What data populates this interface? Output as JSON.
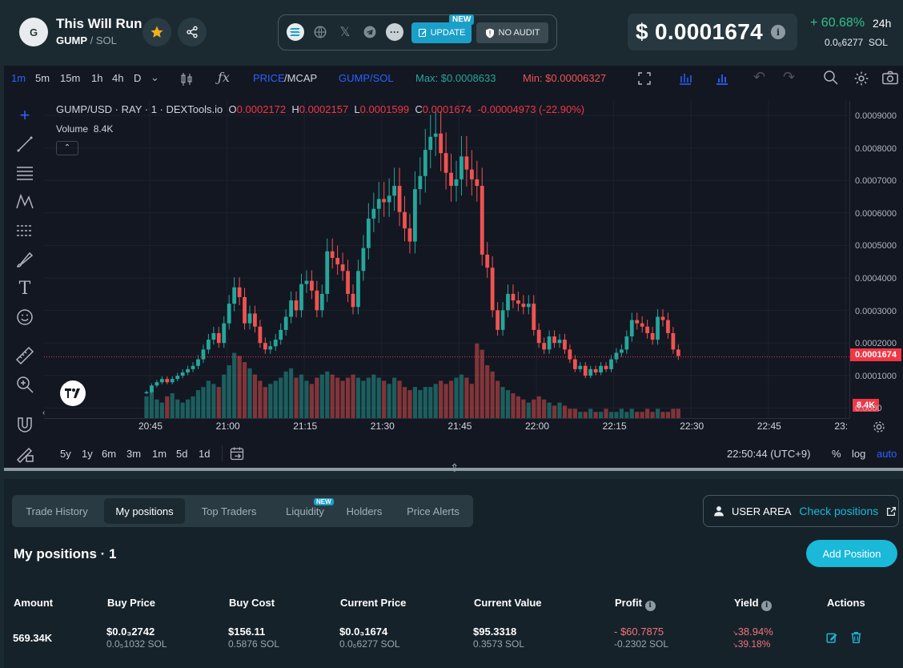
{
  "header": {
    "avatar_letter": "G",
    "token_name": "This Will Run",
    "base": "GUMP",
    "separator": " / ",
    "quote": "SOL",
    "social": {
      "update_label": "UPDATE",
      "new_badge": "NEW",
      "no_audit_label": "NO AUDIT"
    },
    "price": "$ 0.0001674",
    "change": "+ 60.68%",
    "change_timeframe": "24h",
    "sol_price": "0.0₆6277",
    "sol_unit": "SOL"
  },
  "toolbar": {
    "intervals": [
      "1m",
      "5m",
      "15m",
      "1h",
      "4h",
      "D"
    ],
    "price_label": "PRICE",
    "mcap_label": "/MCAP",
    "pair_label": "GUMP/SOL",
    "max_label": "Max: $0.0008633",
    "min_label": "Min: $0.00006327"
  },
  "legend": {
    "symbol": "GUMP/USD · RAY · 1 · DEXTools.io",
    "o_label": "O",
    "o_val": "0.0002172",
    "h_label": "H",
    "h_val": "0.0002157",
    "l_label": "L",
    "l_val": "0.0001599",
    "c_label": "C",
    "c_val": "0.0001674",
    "chg_val": "-0.00004973 (-22.90%)",
    "volume_label": "Volume",
    "volume_val": "8.4K"
  },
  "axis": {
    "y_ticks": [
      "0.0009000",
      "0.0008000",
      "0.0007000",
      "0.0006000",
      "0.0005000",
      "0.0004000",
      "0.0003000",
      "0.0002000",
      "0.0001000",
      "0.0000"
    ],
    "x_ticks": [
      "20:45",
      "21:00",
      "21:15",
      "21:30",
      "21:45",
      "22:00",
      "22:15",
      "22:30",
      "22:45",
      "23:"
    ],
    "current_price_tag": "0.0001674",
    "volume_tag": "8.4K"
  },
  "bottom_bar": {
    "ranges": [
      "5y",
      "1y",
      "6m",
      "3m",
      "1m",
      "5d",
      "1d"
    ],
    "time": "22:50:44 (UTC+9)",
    "percent": "%",
    "log": "log",
    "auto": "auto"
  },
  "panel": {
    "tabs": [
      "Trade History",
      "My positions",
      "Top Traders",
      "Liquidity",
      "Holders",
      "Price Alerts"
    ],
    "liquidity_badge": "NEW",
    "user_area_label": "USER AREA",
    "check_positions": "Check positions",
    "title": "My positions · 1",
    "add_position": "Add Position",
    "columns": [
      "Amount",
      "Buy Price",
      "Buy Cost",
      "Current Price",
      "Current Value",
      "Profit",
      "Yield",
      "Actions"
    ],
    "row": {
      "amount": "569.34K",
      "buy_price": "$0.0₃2742",
      "buy_price_sol": "0.0₅1032 SOL",
      "buy_cost": "$156.11",
      "buy_cost_sol": "0.5876 SOL",
      "current_price": "$0.0₃1674",
      "current_price_sol": "0.0₆6277 SOL",
      "current_value": "$95.3318",
      "current_value_sol": "0.3573 SOL",
      "profit": "- $60.7875",
      "profit_sol": "-0.2302 SOL",
      "yield_1": "38.94%",
      "yield_2": "39.18%"
    }
  },
  "chart_data": {
    "type": "candlestick",
    "ylim": [
      0,
      0.00093
    ],
    "xlabels": [
      "20:45",
      "21:00",
      "21:15",
      "21:30",
      "21:45",
      "22:00",
      "22:15",
      "22:30",
      "22:45"
    ],
    "close": [
      6e-05,
      8e-05,
      9e-05,
      0.0001,
      9e-05,
      0.0001,
      0.00011,
      0.00012,
      0.00013,
      0.00014,
      0.00016,
      0.00019,
      0.00022,
      0.00024,
      0.00021,
      0.00027,
      0.00033,
      0.00038,
      0.00035,
      0.00027,
      0.0003,
      0.00026,
      0.00021,
      0.00019,
      0.0002,
      0.00022,
      0.00025,
      0.00029,
      0.00034,
      0.00031,
      0.00039,
      0.0004,
      0.00037,
      0.00031,
      0.00036,
      0.00049,
      0.00047,
      0.00045,
      0.00043,
      0.00036,
      0.00032,
      0.00043,
      0.0005,
      0.00059,
      0.00062,
      0.00065,
      0.00064,
      0.00066,
      0.00069,
      0.00061,
      0.00056,
      0.00052,
      0.00068,
      0.00072,
      0.0008,
      0.00084,
      0.00085,
      0.00079,
      0.00073,
      0.00069,
      0.00071,
      0.00078,
      0.00074,
      0.00071,
      0.00069,
      0.00048,
      0.00044,
      0.00031,
      0.00025,
      0.00031,
      0.00036,
      0.00034,
      0.00033,
      0.00032,
      0.00033,
      0.00025,
      0.00021,
      0.00019,
      0.00023,
      0.00021,
      0.00022,
      0.00019,
      0.00016,
      0.00013,
      0.00014,
      0.00011,
      0.00013,
      0.00012,
      0.00014,
      0.00013,
      0.00016,
      0.00018,
      0.00019,
      0.00023,
      0.00028,
      0.00027,
      0.00026,
      0.00024,
      0.00022,
      0.00029,
      0.00028,
      0.00024,
      0.00019,
      0.00017
    ],
    "volume": [
      7e-05,
      9e-05,
      6e-05,
      5e-05,
      7e-05,
      8e-05,
      6e-05,
      5e-05,
      6e-05,
      7e-05,
      9e-05,
      0.0001,
      0.00012,
      0.00011,
      0.0001,
      0.00014,
      0.00017,
      0.00021,
      0.0002,
      0.00018,
      0.00016,
      0.00014,
      0.00012,
      0.0001,
      0.00011,
      0.00012,
      0.00013,
      0.00015,
      0.00016,
      0.00013,
      0.00014,
      0.00012,
      0.00011,
      0.00013,
      0.00014,
      0.00015,
      0.00014,
      0.00013,
      0.00012,
      0.00013,
      0.00014,
      0.00013,
      0.00012,
      0.00013,
      0.00014,
      0.00013,
      0.00012,
      0.00011,
      0.00013,
      0.00012,
      0.0001,
      9e-05,
      0.0001,
      9e-05,
      0.0001,
      0.0001,
      0.00011,
      0.00012,
      0.00011,
      0.00012,
      0.00013,
      0.00014,
      0.00013,
      0.00011,
      0.00024,
      0.00022,
      0.00017,
      0.00015,
      0.00012,
      0.0001,
      9e-05,
      8e-05,
      7e-05,
      6e-05,
      5e-05,
      6e-05,
      7e-05,
      6e-05,
      5e-05,
      4e-05,
      5e-05,
      4e-05,
      3e-05,
      3e-05,
      2e-05,
      2e-05,
      3e-05,
      2e-05,
      2e-05,
      3e-05,
      2e-05,
      2e-05,
      3e-05,
      2e-05,
      3e-05,
      2e-05,
      2e-05,
      3e-05,
      2e-05,
      3e-05,
      2e-05,
      2e-05,
      3e-05,
      3e-05
    ],
    "current_price": 0.0001674
  },
  "colors": {
    "up": "#26a69a",
    "down": "#ef5350",
    "accent": "#1ab8d9",
    "positive": "#2fc089",
    "negative": "#f23645"
  }
}
